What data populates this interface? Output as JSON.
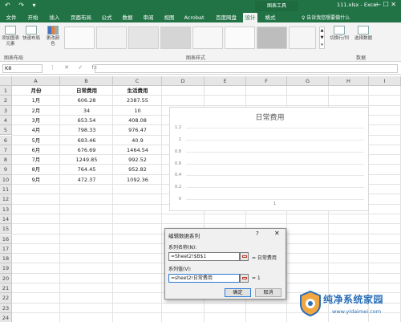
{
  "window": {
    "context_tab_title": "图表工具",
    "doc_title": "111.xlsx - Excel",
    "controls": "—  ☐  ✕",
    "quick_access": [
      "↶",
      "↷",
      "▾"
    ]
  },
  "ribbon_tabs": [
    "文件",
    "开始",
    "插入",
    "页面布局",
    "公式",
    "数据",
    "审阅",
    "视图",
    "Acrobat",
    "百度网盘",
    "设计",
    "格式"
  ],
  "active_tab": "设计",
  "tell_me": "♀ 告诉我您想要做什么",
  "ribbon": {
    "add_element": "添加图表元素",
    "quick_layout": "快速布局",
    "change_colors": "更改颜色",
    "group_layouts": "图表布局",
    "group_styles": "图表样式",
    "switch_row_col": "切换行/列",
    "select_data": "选择数据",
    "group_data": "数据",
    "gallery_arrows": [
      "▲",
      "▼",
      "▾"
    ]
  },
  "formula_bar": {
    "name_box": "K8",
    "icons": [
      "⋮",
      "✕",
      "✓",
      "fx"
    ]
  },
  "columns": [
    "A",
    "B",
    "C",
    "D",
    "E",
    "F",
    "G",
    "H",
    "I"
  ],
  "rows": [
    "1",
    "2",
    "3",
    "4",
    "5",
    "6",
    "7",
    "8",
    "9",
    "10",
    "11",
    "12",
    "13",
    "14",
    "15",
    "16",
    "17",
    "18",
    "19",
    "20",
    "21",
    "22",
    "23",
    "24"
  ],
  "table": {
    "headers": [
      "月份",
      "日常费用",
      "生活费用"
    ],
    "rows": [
      [
        "1月",
        "606.28",
        "2387.55"
      ],
      [
        "2月",
        "34",
        "10"
      ],
      [
        "3月",
        "653.54",
        "408.08"
      ],
      [
        "4月",
        "798.33",
        "976.47"
      ],
      [
        "5月",
        "693.46",
        "40.9"
      ],
      [
        "6月",
        "676.69",
        "1464.54"
      ],
      [
        "7月",
        "1249.85",
        "992.52"
      ],
      [
        "8月",
        "764.45",
        "952.82"
      ],
      [
        "9月",
        "472.37",
        "1092.36"
      ]
    ]
  },
  "chart_data": {
    "type": "line",
    "title": "日常费用",
    "x": [
      "1"
    ],
    "ylim": [
      0,
      1.2
    ],
    "yticks": [
      "1.2",
      "1",
      "0.8",
      "0.6",
      "0.4",
      "0.2",
      "0"
    ],
    "series": [
      {
        "name": "日常费用",
        "values": [
          1
        ]
      }
    ],
    "grid": true,
    "legend": "none"
  },
  "dialog": {
    "title": "编辑数据系列",
    "help": "?",
    "close": "✕",
    "series_name_label": "系列名称(N):",
    "series_name_value": "=Sheet2!$B$1",
    "series_name_preview": "= 日常费用",
    "series_values_label": "系列值(V):",
    "series_values_value": "=sheet2!日常费用",
    "series_values_preview": "= 1",
    "ok": "确定",
    "cancel": "取消"
  },
  "watermark": {
    "text": "纯净系统家园",
    "url": "www.yidaimei.com"
  }
}
